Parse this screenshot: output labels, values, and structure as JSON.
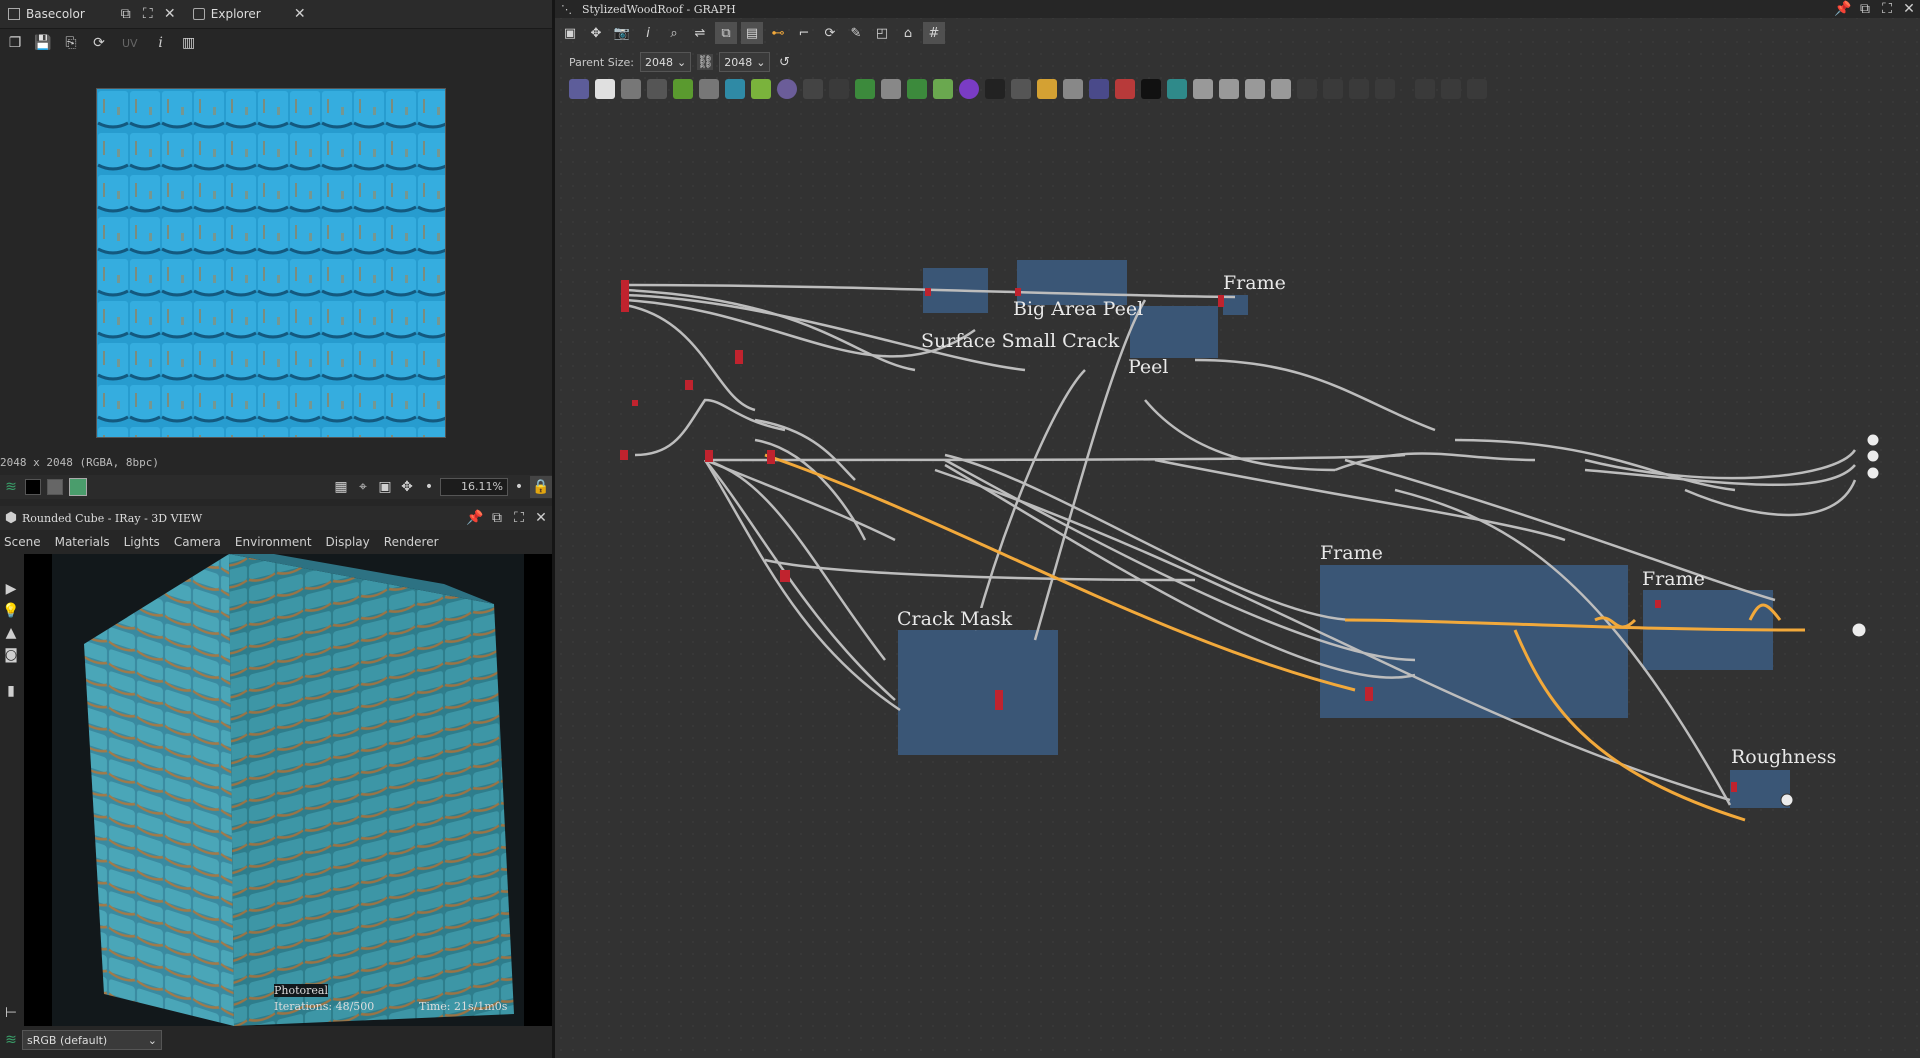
{
  "basecolor_panel": {
    "tab1_label": "Basecolor",
    "tab2_label": "Explorer",
    "uv_label": "UV",
    "status": "2048 x 2048 (RGBA, 8bpc)",
    "zoom": "16.11%"
  },
  "view3d": {
    "title": "Rounded Cube - IRay - 3D VIEW",
    "menu": [
      "Scene",
      "Materials",
      "Lights",
      "Camera",
      "Environment",
      "Display",
      "Renderer"
    ],
    "render_mode": "Photoreal",
    "iterations": "Iterations: 48/500",
    "time": "Time: 21s/1m0s",
    "colorspace": "sRGB (default)"
  },
  "graph": {
    "title": "StylizedWoodRoof - GRAPH",
    "parent_size_label": "Parent Size:",
    "size_w": "2048",
    "size_h": "2048",
    "frames": {
      "frame_top": "Frame",
      "big_area_peel": "Big Area Peel",
      "surface_small_crack": "Surface Small Crack",
      "peel": "Peel",
      "crack_mask": "Crack Mask",
      "frame_mid": "Frame",
      "frame_right": "Frame",
      "roughness": "Roughness"
    }
  },
  "colors": {
    "frame_fill": "#3b5a7d",
    "wire": "#bdbdbd",
    "wire_active": "#f2a93b",
    "port": "#c0232e"
  }
}
